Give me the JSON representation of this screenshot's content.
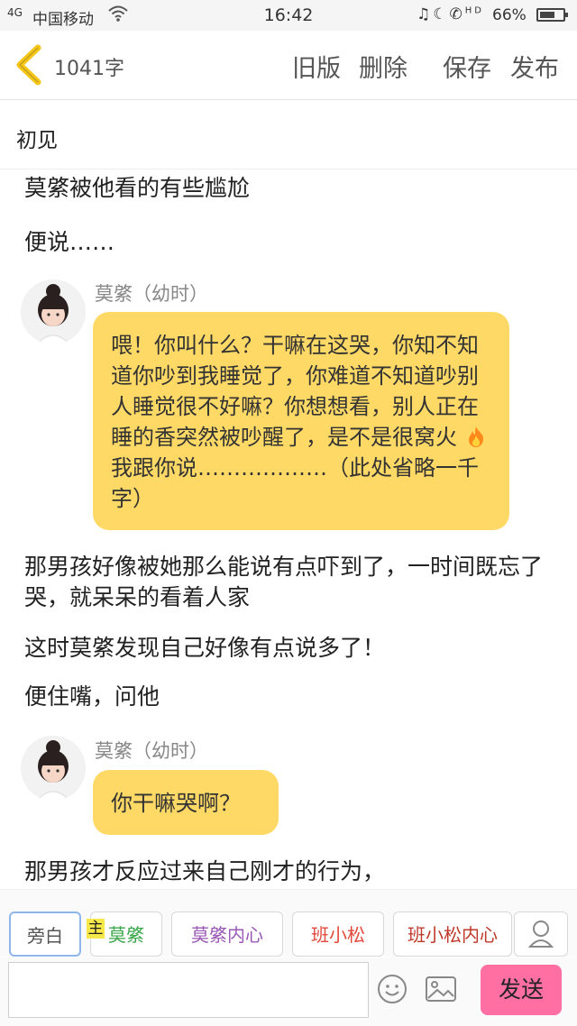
{
  "status": {
    "signal": "4G",
    "carrier": "中国移动",
    "time": "16:42",
    "hd": "HD",
    "battery": "66%",
    "battery_level": 0.66
  },
  "header": {
    "word_count": "1041字",
    "actions": [
      "旧版",
      "删除",
      "保存",
      "发布"
    ]
  },
  "chapter_title": "初见",
  "story": {
    "p1": "莫綮被他看的有些尴尬",
    "p2": "便说……",
    "dialog1": {
      "speaker": "莫綮（幼时）",
      "text_before": "喂！你叫什么？干嘛在这哭，你知不知道你吵到我睡觉了，你难道不知道吵别人睡觉很不好嘛？你想想看，别人正在睡的香突然被吵醒了，是不是很窝火",
      "emoji": "fire-emoji",
      "text_after": "我跟你说………………（此处省略一千字）"
    },
    "p3": "那男孩好像被她那么能说有点吓到了，一时间既忘了哭，就呆呆的看着人家",
    "p4": "这时莫綮发现自己好像有点说多了！",
    "p5": "便住嘴，问他",
    "dialog2": {
      "speaker": "莫綮（幼时）",
      "text": "你干嘛哭啊？"
    },
    "p6": "那男孩才反应过来自己刚才的行为，"
  },
  "roles": {
    "main_mark": "主",
    "items": [
      {
        "label": "旁白",
        "color": "#555555"
      },
      {
        "label": "莫綮",
        "color": "#3aa64a"
      },
      {
        "label": "莫綮内心",
        "color": "#9b59b6"
      },
      {
        "label": "班小松",
        "color": "#e2483b"
      },
      {
        "label": "班小松内心",
        "color": "#c0392b"
      }
    ]
  },
  "input": {
    "placeholder": "",
    "send_label": "发送"
  },
  "colors": {
    "accent": "#ffd966",
    "send": "#ff6fa2",
    "back_arrow": "#f5c518"
  }
}
